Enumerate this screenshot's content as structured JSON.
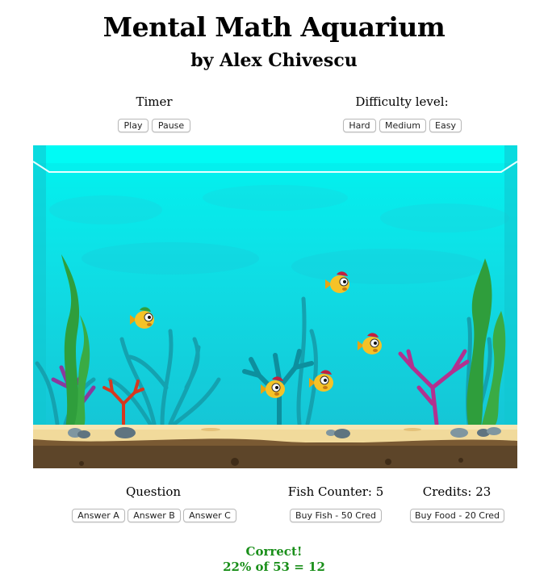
{
  "header": {
    "title": "Mental Math Aquarium",
    "subtitle": "by Alex Chivescu"
  },
  "timer": {
    "label": "Timer",
    "play": "Play",
    "pause": "Pause"
  },
  "difficulty": {
    "label": "Difficulty level:",
    "hard": "Hard",
    "medium": "Medium",
    "easy": "Easy"
  },
  "question": {
    "label": "Question",
    "answers": [
      "Answer A",
      "Answer B",
      "Answer C"
    ]
  },
  "fish": {
    "counter_label": "Fish Counter: 5",
    "buy_fish": "Buy Fish - 50 Cred"
  },
  "credits": {
    "label": "Credits: 23",
    "buy_food": "Buy Food - 20 Cred"
  },
  "feedback": {
    "status": "Correct!",
    "equation": "22% of 53 = 12"
  },
  "colors": {
    "water_top": "#00f2ee",
    "water_bottom": "#12c4d6",
    "sand": "#f0d99a",
    "correct": "#1a8f1a"
  }
}
